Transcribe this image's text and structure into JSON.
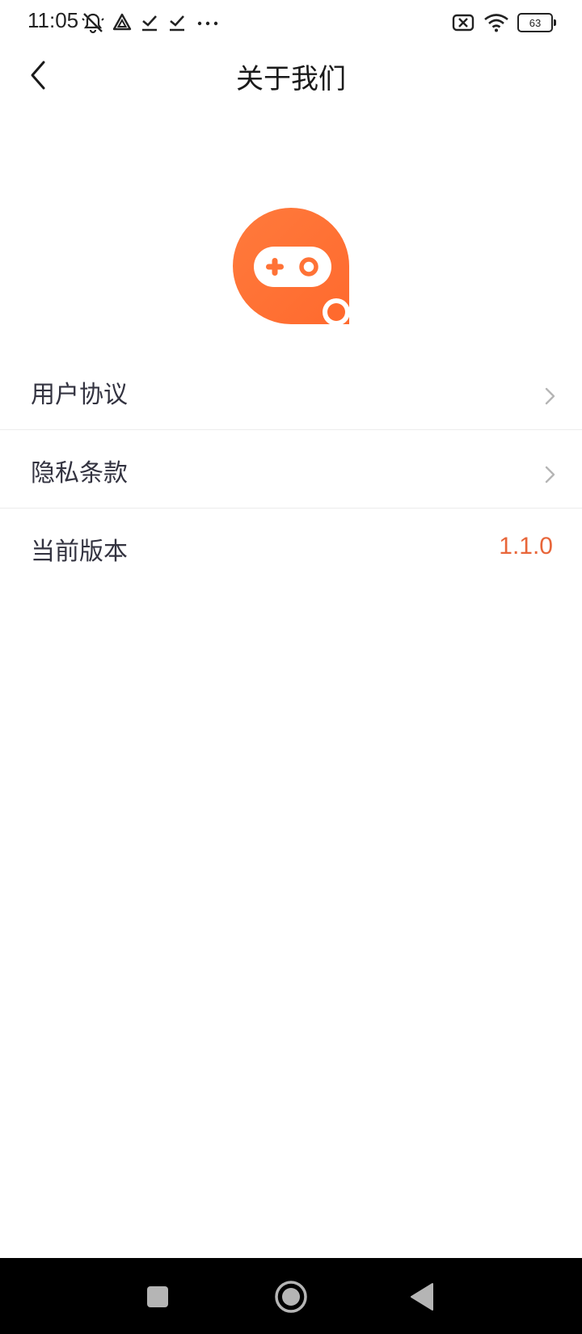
{
  "status_bar": {
    "time": "11:05",
    "left_icons": [
      "mute-icon",
      "drive-icon",
      "download-done-icon",
      "download-done-icon",
      "more-dots-icon"
    ],
    "right_icons": [
      "sim-off-icon",
      "wifi-icon",
      "battery-icon"
    ],
    "battery_level": "63"
  },
  "header": {
    "title": "关于我们",
    "back_icon": "chevron-left-icon"
  },
  "logo": {
    "icon": "gamepad-chat-logo",
    "color": "#ff7a3c"
  },
  "list": {
    "items": [
      {
        "label": "用户协议",
        "trailing": "chevron-right-icon"
      },
      {
        "label": "隐私条款",
        "trailing": "chevron-right-icon"
      },
      {
        "label": "当前版本",
        "value": "1.1.0"
      }
    ]
  },
  "colors": {
    "accent": "#e8663a",
    "text": "#333340",
    "divider": "#ececec"
  },
  "nav_bar": {
    "buttons": [
      "recent-apps-icon",
      "home-icon",
      "back-triangle-icon"
    ]
  }
}
